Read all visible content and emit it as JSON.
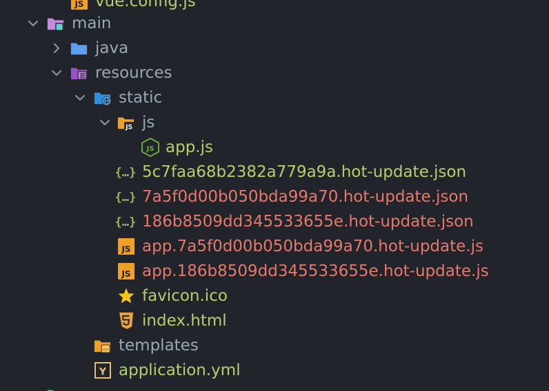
{
  "colors": {
    "background": "#21252b",
    "folder_label": "#9aa8b5",
    "new_file_label": "#b5cf6b",
    "modified_file_label": "#e8786a",
    "js_badge": "#f0a028",
    "main_folder": "#c58ae0",
    "java_folder": "#5e9ef0",
    "resources_folder": "#9a4fd0",
    "static_folder": "#2f8ee0",
    "json_braces": "#9fb45a",
    "star": "#f5c518"
  },
  "tree": {
    "vue_config": {
      "label": "vue.config.js",
      "icon": "js-file-icon"
    },
    "main": {
      "label": "main",
      "icon": "folder-main-icon"
    },
    "java": {
      "label": "java",
      "icon": "folder-java-icon"
    },
    "resources": {
      "label": "resources",
      "icon": "folder-resources-icon"
    },
    "static": {
      "label": "static",
      "icon": "folder-static-web-icon"
    },
    "js": {
      "label": "js",
      "icon": "folder-js-icon"
    },
    "app_js": {
      "label": "app.js",
      "icon": "nodejs-icon"
    },
    "files": [
      {
        "label": "5c7faa68b2382a779a9a.hot-update.json",
        "icon": "json-icon",
        "status": "new"
      },
      {
        "label": "7a5f0d00b050bda99a70.hot-update.json",
        "icon": "json-icon",
        "status": "modified"
      },
      {
        "label": "186b8509dd345533655e.hot-update.json",
        "icon": "json-icon",
        "status": "modified"
      },
      {
        "label": "app.7a5f0d00b050bda99a70.hot-update.js",
        "icon": "js-file-icon",
        "status": "modified"
      },
      {
        "label": "app.186b8509dd345533655e.hot-update.js",
        "icon": "js-file-icon",
        "status": "modified"
      },
      {
        "label": "favicon.ico",
        "icon": "star-icon",
        "status": "new"
      },
      {
        "label": "index.html",
        "icon": "html5-icon",
        "status": "new"
      }
    ],
    "templates": {
      "label": "templates",
      "icon": "folder-templates-icon"
    },
    "application_yml": {
      "label": "application.yml",
      "icon": "yaml-icon"
    },
    "next_folder": {
      "label": "",
      "icon": "folder-icon"
    }
  }
}
